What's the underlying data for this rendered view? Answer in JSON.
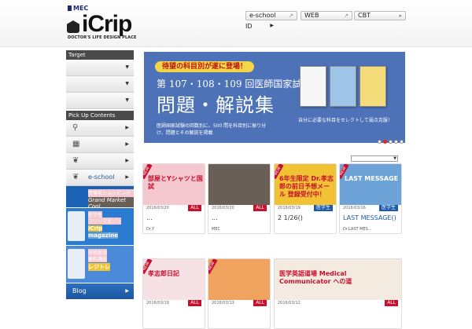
{
  "brand": {
    "mec": "MEC",
    "logo": "iCrip",
    "tagline": "DOCTOR'S LIFE DESIGN PLACE"
  },
  "header_buttons": [
    {
      "label": "e-school",
      "icon": "external-link-icon"
    },
    {
      "label": "WEB",
      "icon": "external-link-icon"
    },
    {
      "label": "CBT",
      "icon": "chevron-right-icon"
    }
  ],
  "id_link": "ID",
  "sidebar": {
    "target_heading": "Target",
    "pickup_heading": "Pick Up Contents",
    "eschool_label": "e-school",
    "ads": [
      {
        "line1": "医療系ショッピングサイト",
        "line2": "Grand Market Cool"
      },
      {
        "line1": "医学生",
        "line2": "フリーマガジン",
        "line3": "iCrip",
        "line4": "magazine"
      },
      {
        "line1": "研修医用",
        "line2": "無料講座",
        "line3": "レジトレ"
      }
    ],
    "blog_label": "Blog"
  },
  "banner": {
    "tag": "待望の科目別が遂に登場！",
    "subtitle": "第 107・108・109 回医師国家試験",
    "main": "問題・解説集",
    "desc": "医師国家試験の回数別に、500 問を科目別に振り分け、問題とその解説を掲載",
    "right_text": "自分に必要な科目をセレクトして弱点克服！",
    "dots": 5,
    "active_dot": 1
  },
  "sort_select": "▼",
  "cards": [
    {
      "date": "2016/03/20",
      "cat": "ALL",
      "title": "...",
      "src": "Dr.Y",
      "thumb_text": "部屋とYシャツと国試",
      "thumb": "t1",
      "new": true
    },
    {
      "date": "2016/03/20",
      "cat": "ALL",
      "title": "...",
      "src": "MEC",
      "thumb_text": "",
      "thumb": "t2",
      "new": false
    },
    {
      "date": "2016/03/19",
      "cat": "医学生",
      "title": "2 1/26()",
      "src": "",
      "thumb_text": "6年生限定 Dr.孝志郎の前日予想メール 登録受付中！",
      "thumb": "t3",
      "new": true
    },
    {
      "date": "2016/03/16",
      "cat": "医学生",
      "title": "LAST MESSAGE()",
      "src": "Dr.LAST MES...",
      "thumb_text": "LAST MESSAGE",
      "thumb": "t4",
      "new": true,
      "blue": true
    },
    {
      "date": "2016/03/19",
      "cat": "ALL",
      "title": "",
      "src": "",
      "thumb_text": "孝志郎日記",
      "thumb": "t5",
      "new": true
    },
    {
      "date": "2016/03/13",
      "cat": "ALL",
      "title": "",
      "src": "",
      "thumb_text": "",
      "thumb": "t6",
      "new": true
    },
    {
      "date": "2016/03/12",
      "cat": "ALL",
      "title": "",
      "src": "",
      "thumb_text": "医学英語道場 Medical Communicator への道",
      "thumb": "t7",
      "new": false
    }
  ]
}
